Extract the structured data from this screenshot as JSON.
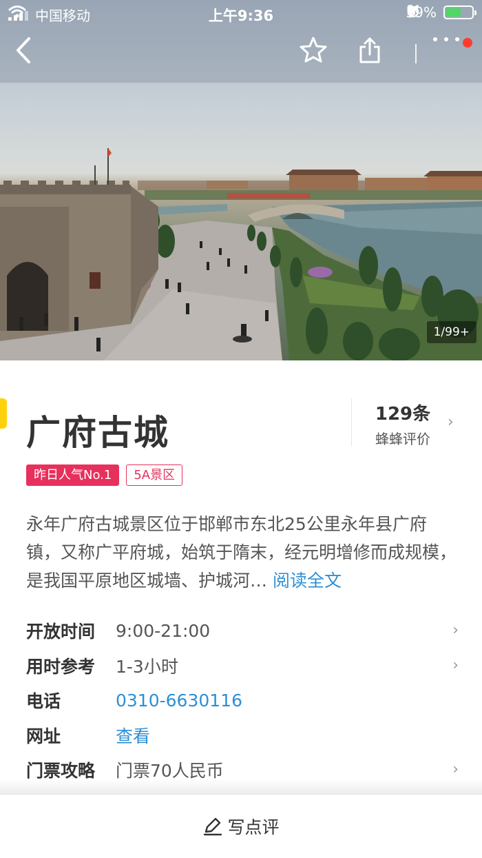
{
  "status_bar": {
    "carrier": "中国移动",
    "time": "上午9:36",
    "battery_percent": "59%",
    "battery_level": 0.59,
    "battery_color": "#4cd964"
  },
  "nav": {
    "icons": [
      "back-icon",
      "star-icon",
      "share-icon",
      "more-icon"
    ],
    "notification_dot_color": "#ff3b30"
  },
  "gallery": {
    "counter": "1/99+"
  },
  "poi": {
    "name": "广府古城",
    "review_count": "129条",
    "review_label": "蜂蜂评价",
    "tags": [
      {
        "text": "昨日人气No.1",
        "style": "filled"
      },
      {
        "text": "5A景区",
        "style": "outline"
      }
    ],
    "tag_color": "#e8305d",
    "description": "永年广府古城景区位于邯郸市东北25公里永年县广府镇，又称广平府城，始筑于隋末，经元明增修而成规模，是我国平原地区城墙、护城河…",
    "read_more": "阅读全文",
    "link_color": "#2d8fd5"
  },
  "info_rows": [
    {
      "label": "开放时间",
      "value": "9:00-21:00",
      "link": false,
      "chevron": true
    },
    {
      "label": "用时参考",
      "value": "1-3小时",
      "link": false,
      "chevron": true
    },
    {
      "label": "电话",
      "value": "0310-6630116",
      "link": true,
      "chevron": false
    },
    {
      "label": "网址",
      "value": "查看",
      "link": true,
      "chevron": false
    },
    {
      "label": "门票攻略",
      "value": "门票70人民币",
      "link": false,
      "chevron": true
    }
  ],
  "bottom_bar": {
    "write_review": "写点评",
    "icon": "pen-icon"
  }
}
